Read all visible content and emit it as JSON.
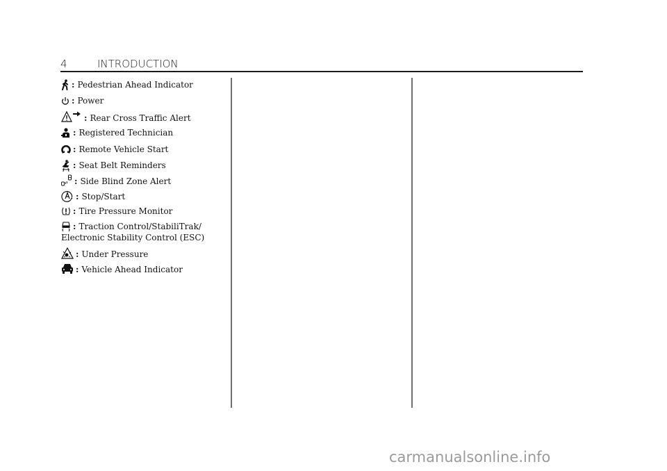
{
  "header": {
    "page_number": "4",
    "section_title": "INTRODUCTION"
  },
  "entries": [
    {
      "icon": "pedestrian-icon",
      "label": "Pedestrian Ahead Indicator"
    },
    {
      "icon": "power-icon",
      "label": "Power"
    },
    {
      "icon": "rear-cross-traffic-icon",
      "label": "Rear Cross Traffic Alert"
    },
    {
      "icon": "registered-technician-icon",
      "label": "Registered Technician"
    },
    {
      "icon": "remote-start-icon",
      "label": "Remote Vehicle Start"
    },
    {
      "icon": "seat-belt-icon",
      "label": "Seat Belt Reminders"
    },
    {
      "icon": "side-blind-zone-icon",
      "label": "Side Blind Zone Alert"
    },
    {
      "icon": "stop-start-icon",
      "label": "Stop/Start"
    },
    {
      "icon": "tire-pressure-icon",
      "label": "Tire Pressure Monitor"
    },
    {
      "icon": "traction-control-icon",
      "label": "Traction Control/StabiliTrak/",
      "label_line2": "Electronic Stability Control (ESC)"
    },
    {
      "icon": "under-pressure-icon",
      "label": "Under Pressure"
    },
    {
      "icon": "vehicle-ahead-icon",
      "label": "Vehicle Ahead Indicator"
    }
  ],
  "separator": ":",
  "watermark": "carmanualsonline.info"
}
